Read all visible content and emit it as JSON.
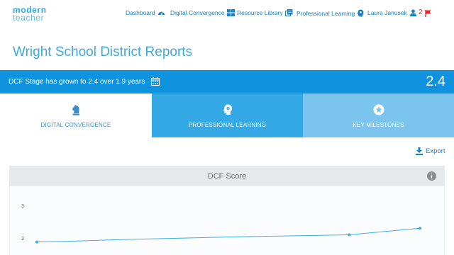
{
  "brand": {
    "line1": "modern",
    "line2": "teacher"
  },
  "nav": {
    "items": [
      {
        "label": "Dashboard",
        "icon": "dashboard-gauge-icon"
      },
      {
        "label": "Digital Convergence",
        "icon": "grid-icon"
      },
      {
        "label": "Resource Library",
        "icon": "library-icon"
      },
      {
        "label": "Professional Learning",
        "icon": "head-gear-icon"
      }
    ],
    "user_name": "Laura Janusek",
    "notification_count": "2"
  },
  "page_title": "Wright School District Reports",
  "banner": {
    "text": "DCF Stage has grown to 2.4 over 1.9 years",
    "value": "2.4"
  },
  "tabs": [
    {
      "label": "DIGITAL CONVERGENCE",
      "icon": "knight-icon",
      "active": true
    },
    {
      "label": "PROFESSIONAL LEARNING",
      "icon": "head-gear-icon",
      "active": false
    },
    {
      "label": "KEY MILESTONES",
      "icon": "star-badge-icon",
      "active": false
    }
  ],
  "export_label": "Export",
  "chart_title": "DCF Score",
  "colors": {
    "accent": "#0f93de",
    "link": "#1b7fc0",
    "alert": "#e8262e"
  },
  "chart_data": {
    "type": "line",
    "title": "DCF Score",
    "xlabel": "",
    "ylabel": "",
    "y_tick_labels": [
      "3",
      "2"
    ],
    "x": [
      0,
      0.2,
      0.4,
      0.6,
      0.8,
      1.0,
      1.55,
      1.9
    ],
    "y": [
      1.9,
      1.93,
      1.97,
      2.0,
      2.03,
      2.06,
      2.12,
      2.32
    ],
    "ylim": [
      1.0,
      3.0
    ],
    "grid": false
  }
}
